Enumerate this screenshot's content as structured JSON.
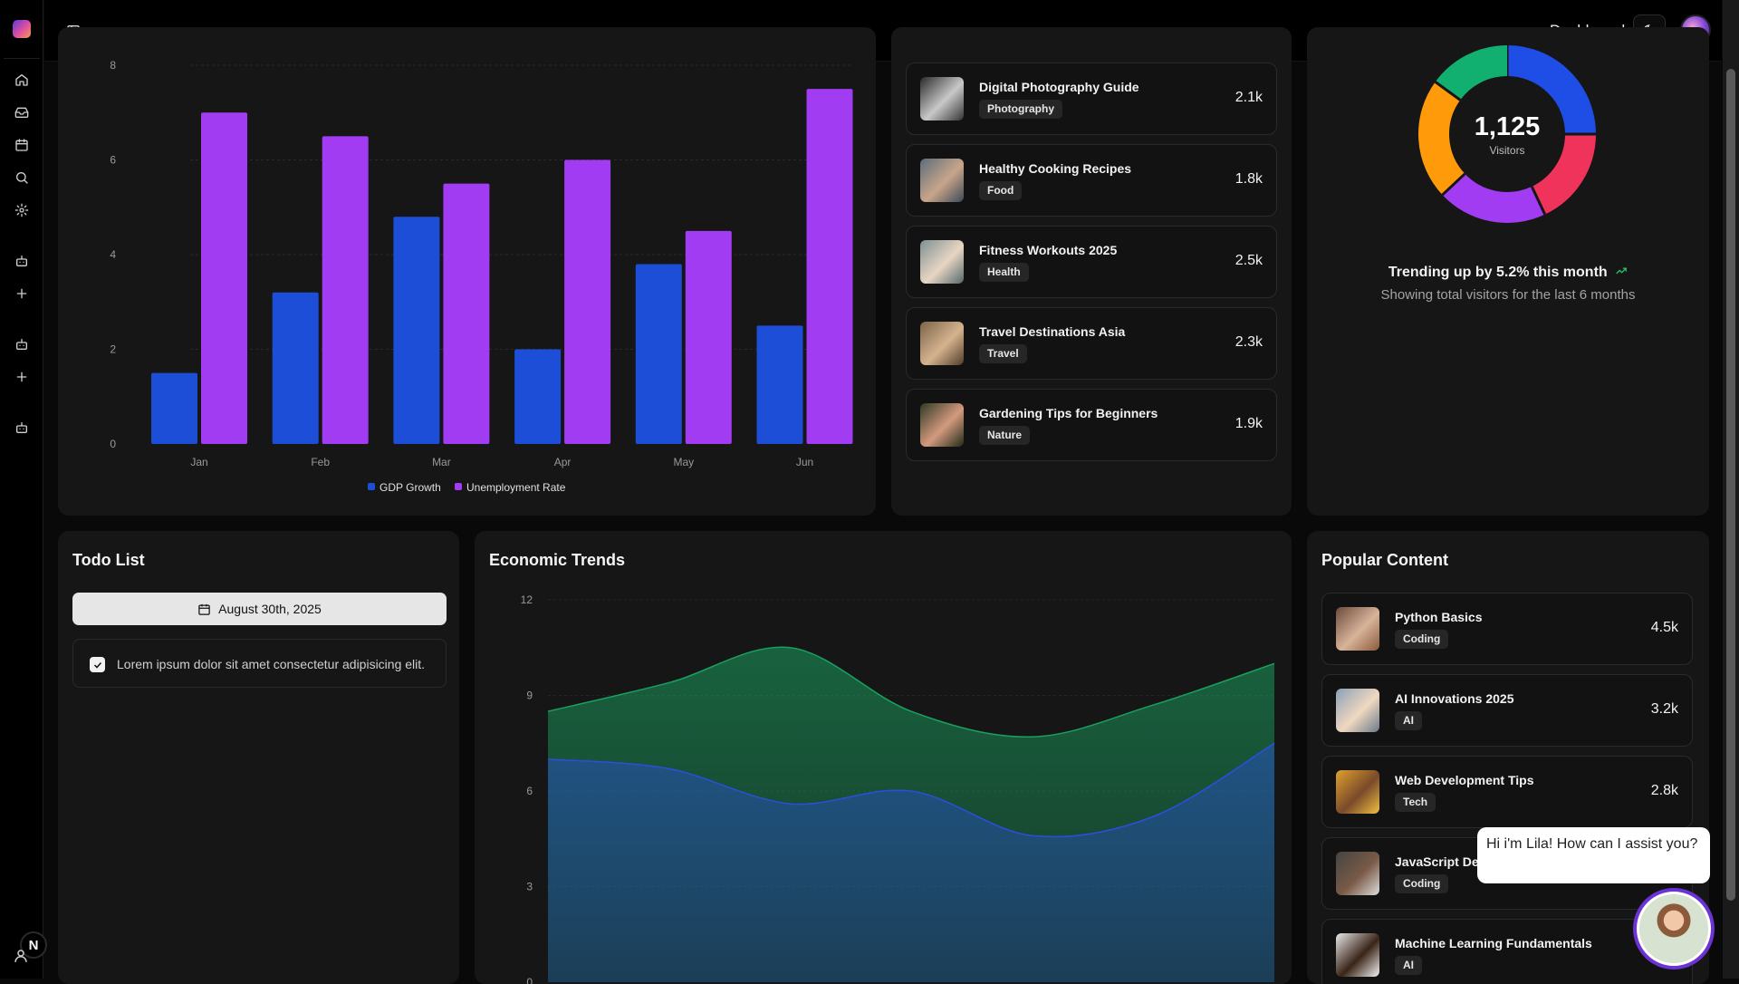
{
  "header": {
    "title": "Dashboard"
  },
  "bar_chart": {
    "legend": [
      "GDP Growth",
      "Unemployment Rate"
    ]
  },
  "chart_data": [
    {
      "type": "bar",
      "categories": [
        "Jan",
        "Feb",
        "Mar",
        "Apr",
        "May",
        "Jun"
      ],
      "series": [
        {
          "name": "GDP Growth",
          "values": [
            1.5,
            3.2,
            4.8,
            2.0,
            3.8,
            2.5
          ],
          "color": "#1d4ed8"
        },
        {
          "name": "Unemployment Rate",
          "values": [
            7.0,
            6.5,
            5.5,
            6.0,
            4.5,
            7.5
          ],
          "color": "#a23cf2"
        }
      ],
      "ylim": [
        0,
        8
      ],
      "yticks": [
        0,
        2,
        4,
        6,
        8
      ],
      "grid": true,
      "legend": "bottom"
    },
    {
      "type": "area",
      "title": "Economic Trends",
      "x": [
        0,
        1,
        2,
        3,
        4,
        5,
        6
      ],
      "series": [
        {
          "values": [
            8.5,
            9.4,
            10.5,
            8.5,
            7.7,
            8.7,
            10.0
          ],
          "color": "#1aa060"
        },
        {
          "values": [
            7.0,
            6.7,
            5.6,
            6.0,
            4.6,
            5.2,
            7.5
          ],
          "color": "#2a4fe0"
        }
      ],
      "ylim": [
        0,
        12
      ],
      "yticks": [
        0,
        3,
        6,
        9,
        12
      ],
      "grid": true
    },
    {
      "type": "pie",
      "center_value": "1,125",
      "center_label": "Visitors",
      "slices": [
        {
          "value": 25,
          "color": "#1f4ee6"
        },
        {
          "value": 18,
          "color": "#f0335a"
        },
        {
          "value": 20,
          "color": "#a23cf2"
        },
        {
          "value": 22,
          "color": "#ff9a0a"
        },
        {
          "value": 15,
          "color": "#12b070"
        }
      ]
    }
  ],
  "mid_list": {
    "items": [
      {
        "title": "Digital Photography Guide",
        "tag": "Photography",
        "value": "2.1k"
      },
      {
        "title": "Healthy Cooking Recipes",
        "tag": "Food",
        "value": "1.8k"
      },
      {
        "title": "Fitness Workouts 2025",
        "tag": "Health",
        "value": "2.5k"
      },
      {
        "title": "Travel Destinations Asia",
        "tag": "Travel",
        "value": "2.3k"
      },
      {
        "title": "Gardening Tips for Beginners",
        "tag": "Nature",
        "value": "1.9k"
      }
    ]
  },
  "visitors": {
    "total": "1,125",
    "label": "Visitors",
    "trend": "Trending up by 5.2% this month",
    "subtitle": "Showing total visitors for the last 6 months"
  },
  "todo": {
    "title": "Todo List",
    "date": "August 30th, 2025",
    "items": [
      {
        "text": "Lorem ipsum dolor sit amet consectetur adipisicing elit.",
        "checked": true
      }
    ]
  },
  "economic": {
    "title": "Economic Trends"
  },
  "popular": {
    "title": "Popular Content",
    "items": [
      {
        "title": "Python Basics",
        "tag": "Coding",
        "value": "4.5k"
      },
      {
        "title": "AI Innovations 2025",
        "tag": "AI",
        "value": "3.2k"
      },
      {
        "title": "Web Development Tips",
        "tag": "Tech",
        "value": "2.8k"
      },
      {
        "title": "JavaScript Dee",
        "tag": "Coding",
        "value": ""
      },
      {
        "title": "Machine Learning Fundamentals",
        "tag": "AI",
        "value": ""
      }
    ]
  },
  "chat": {
    "message": "Hi i'm Lila! How can I assist you?"
  },
  "rail": {
    "badge": "N"
  }
}
